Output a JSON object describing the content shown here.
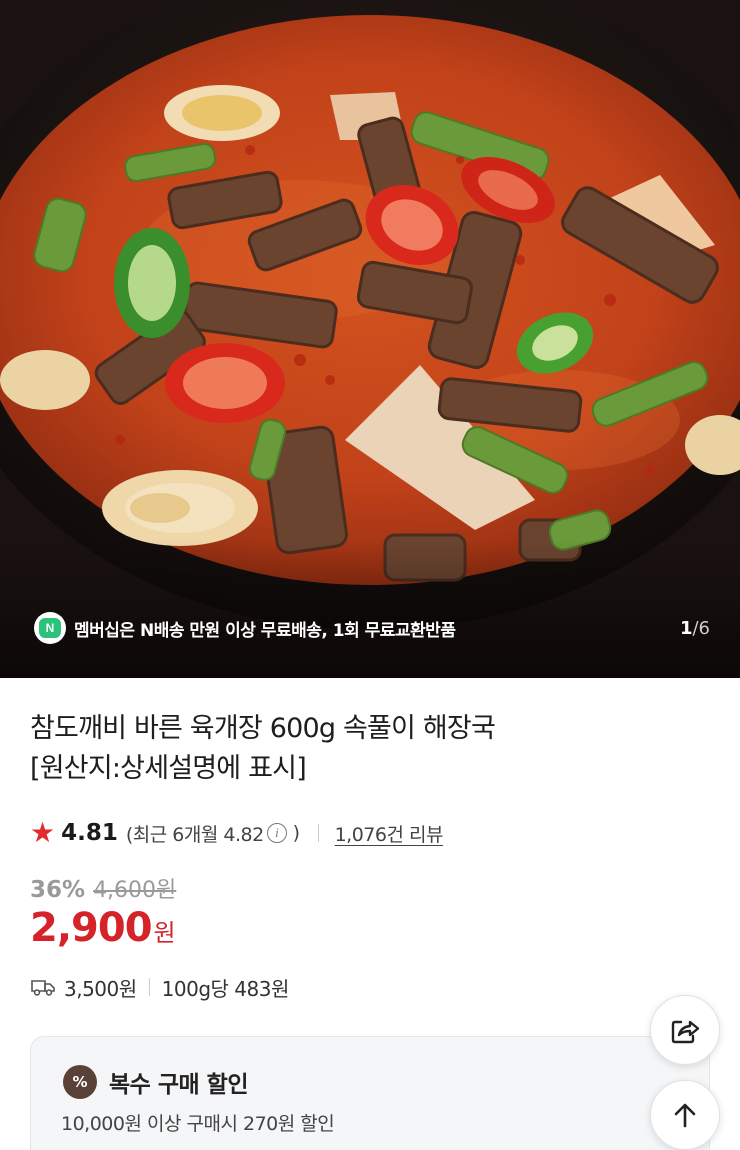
{
  "hero": {
    "image_alt": "육개장",
    "membership_text": "멤버십은 N배송 만원 이상 무료배송, 1회 무료교환반품",
    "membership_badge": "N",
    "counter_current": "1",
    "counter_separator": "/",
    "counter_total": "6"
  },
  "product": {
    "title_line1": "참도깨비 바른 육개장 600g 속풀이 해장국",
    "title_line2": "[원산지:상세설명에 표시]",
    "rating": "4.81",
    "rating_recent": "(최근 6개월 4.82",
    "rating_recent_close": ")",
    "review_count": "1,076건 리뷰",
    "discount_rate": "36%",
    "original_price": "4,600원",
    "sale_price": "2,900",
    "sale_price_unit": "원",
    "shipping_fee": "3,500원",
    "unit_price": "100g당 483원"
  },
  "bulk_discount": {
    "badge": "%",
    "title": "복수 구매 할인",
    "description": "10,000원 이상 구매시 270원 할인"
  },
  "colors": {
    "price_red": "#d5232a",
    "star_red": "#e02c2f",
    "membership_green": "#2bc37a"
  },
  "icons": {
    "share": "share-icon",
    "scroll_top": "arrow-up-icon",
    "shipping": "truck-icon",
    "info": "info-icon",
    "star": "star-icon"
  }
}
